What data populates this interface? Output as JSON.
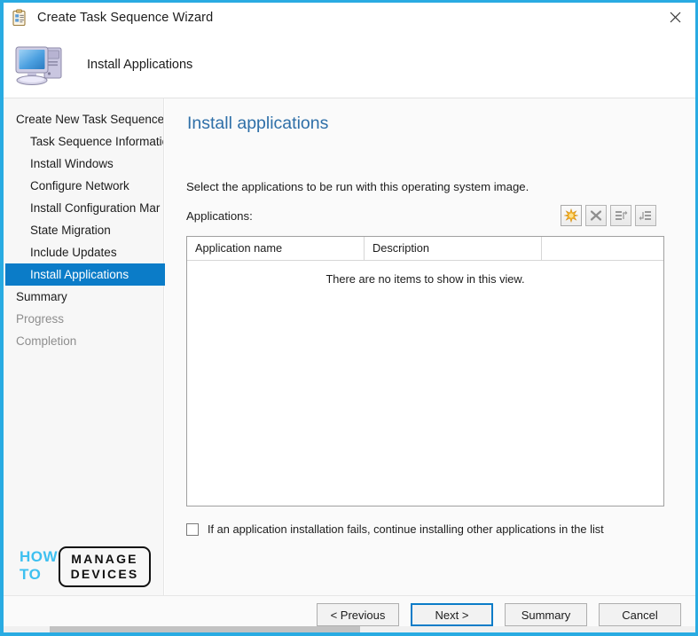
{
  "window": {
    "title": "Create Task Sequence Wizard",
    "title_icon": "clipboard-checklist-icon",
    "close_label": "✕"
  },
  "header": {
    "title": "Install Applications",
    "icon": "computer-monitor-icon"
  },
  "sidebar": {
    "items": [
      {
        "label": "Create New Task Sequence",
        "indent": false,
        "state": "normal"
      },
      {
        "label": "Task Sequence Informatio",
        "indent": true,
        "state": "normal"
      },
      {
        "label": "Install Windows",
        "indent": true,
        "state": "normal"
      },
      {
        "label": "Configure Network",
        "indent": true,
        "state": "normal"
      },
      {
        "label": "Install Configuration Mar",
        "indent": true,
        "state": "normal"
      },
      {
        "label": "State Migration",
        "indent": true,
        "state": "normal"
      },
      {
        "label": "Include Updates",
        "indent": true,
        "state": "normal"
      },
      {
        "label": "Install Applications",
        "indent": true,
        "state": "selected"
      },
      {
        "label": "Summary",
        "indent": false,
        "state": "normal"
      },
      {
        "label": "Progress",
        "indent": false,
        "state": "disabled"
      },
      {
        "label": "Completion",
        "indent": false,
        "state": "disabled"
      }
    ],
    "selected_color": "#0b7cc8"
  },
  "logo": {
    "how": "HOW",
    "to": "TO",
    "manage": "MANAGE",
    "devices": "DEVICES",
    "accent_color": "#3ec0f0"
  },
  "main": {
    "heading": "Install applications",
    "heading_color": "#2e6fa8",
    "instruction": "Select the applications to be run with this operating system image.",
    "field_label": "Applications:",
    "toolbar": [
      {
        "name": "add-application-button",
        "icon": "starburst-new-icon",
        "active": true
      },
      {
        "name": "remove-application-button",
        "icon": "x-delete-icon",
        "active": false
      },
      {
        "name": "move-up-button",
        "icon": "move-up-list-icon",
        "active": false
      },
      {
        "name": "move-down-button",
        "icon": "move-down-list-icon",
        "active": false
      }
    ],
    "list": {
      "columns": [
        "Application name",
        "Description",
        ""
      ],
      "rows": [],
      "empty_message": "There are no items to show in this view."
    },
    "checkbox": {
      "label": "If an application installation fails, continue installing other applications in the list",
      "checked": false
    }
  },
  "footer": {
    "buttons": [
      {
        "label": "< Previous",
        "default": false
      },
      {
        "label": "Next >",
        "default": true
      },
      {
        "label": "Summary",
        "default": false
      },
      {
        "label": "Cancel",
        "default": false
      }
    ]
  }
}
